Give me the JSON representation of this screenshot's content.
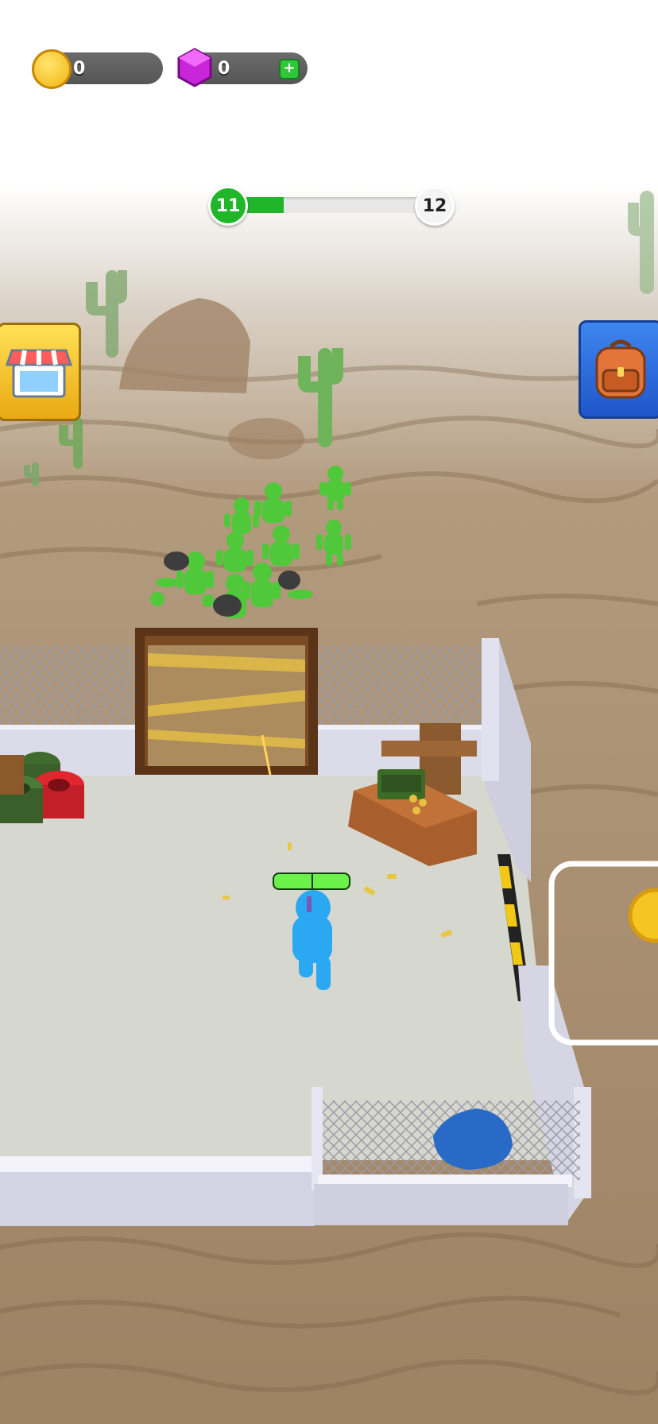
{
  "currencies": {
    "coins": "0",
    "gems": "0",
    "add_label": "+"
  },
  "level": {
    "current": "11",
    "next": "12",
    "progress": 0.28
  },
  "player": {
    "health": 1.0
  },
  "colors": {
    "sand": "#a98d6c",
    "sand_dark": "#8a6f50",
    "floor": "#d6d7ce",
    "wall": "#d9d7e8",
    "zombie": "#4fc83a",
    "player": "#2aa8f2",
    "progress_fill": "#21b52a",
    "shop_bg": "#f2c21e",
    "backpack_bg": "#2a6fe0"
  },
  "icons": {
    "coin": "coin-icon",
    "gem": "gem-icon",
    "add": "plus-icon",
    "shop": "shop-icon",
    "backpack": "backpack-icon"
  }
}
